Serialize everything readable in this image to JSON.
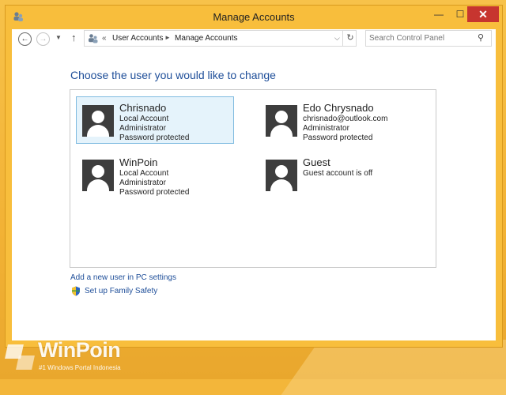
{
  "window": {
    "title": "Manage Accounts",
    "minimize": "—",
    "maximize": "☐",
    "close": "✕"
  },
  "nav": {
    "back": "←",
    "forward": "→",
    "recent": "▼",
    "up": "↑"
  },
  "address": {
    "overflow": "«",
    "crumbs": [
      "User Accounts",
      "Manage Accounts"
    ],
    "separator": "►",
    "dropdown": "⌵",
    "refresh": "↻"
  },
  "search": {
    "placeholder": "Search Control Panel",
    "icon": "⚲"
  },
  "main": {
    "heading": "Choose the user you would like to change",
    "accounts": [
      {
        "name": "Chrisnado",
        "lines": [
          "Local Account",
          "Administrator",
          "Password protected"
        ],
        "selected": true
      },
      {
        "name": "Edo Chrysnado",
        "lines": [
          "chrisnado@outlook.com",
          "Administrator",
          "Password protected"
        ],
        "selected": false
      },
      {
        "name": "WinPoin",
        "lines": [
          "Local Account",
          "Administrator",
          "Password protected"
        ],
        "selected": false
      },
      {
        "name": "Guest",
        "lines": [
          "Guest account is off"
        ],
        "selected": false
      }
    ],
    "add_user_link": "Add a new user in PC settings",
    "family_safety_link": "Set up Family Safety"
  },
  "watermark": {
    "brand": "WinPoin",
    "tagline": "#1 Windows Portal Indonesia"
  },
  "colors": {
    "window_frame": "#f8be3c",
    "link_blue": "#1e4e99",
    "selection_bg": "#e5f3fb",
    "selection_border": "#7fbbe0",
    "close_red": "#c7352f"
  }
}
